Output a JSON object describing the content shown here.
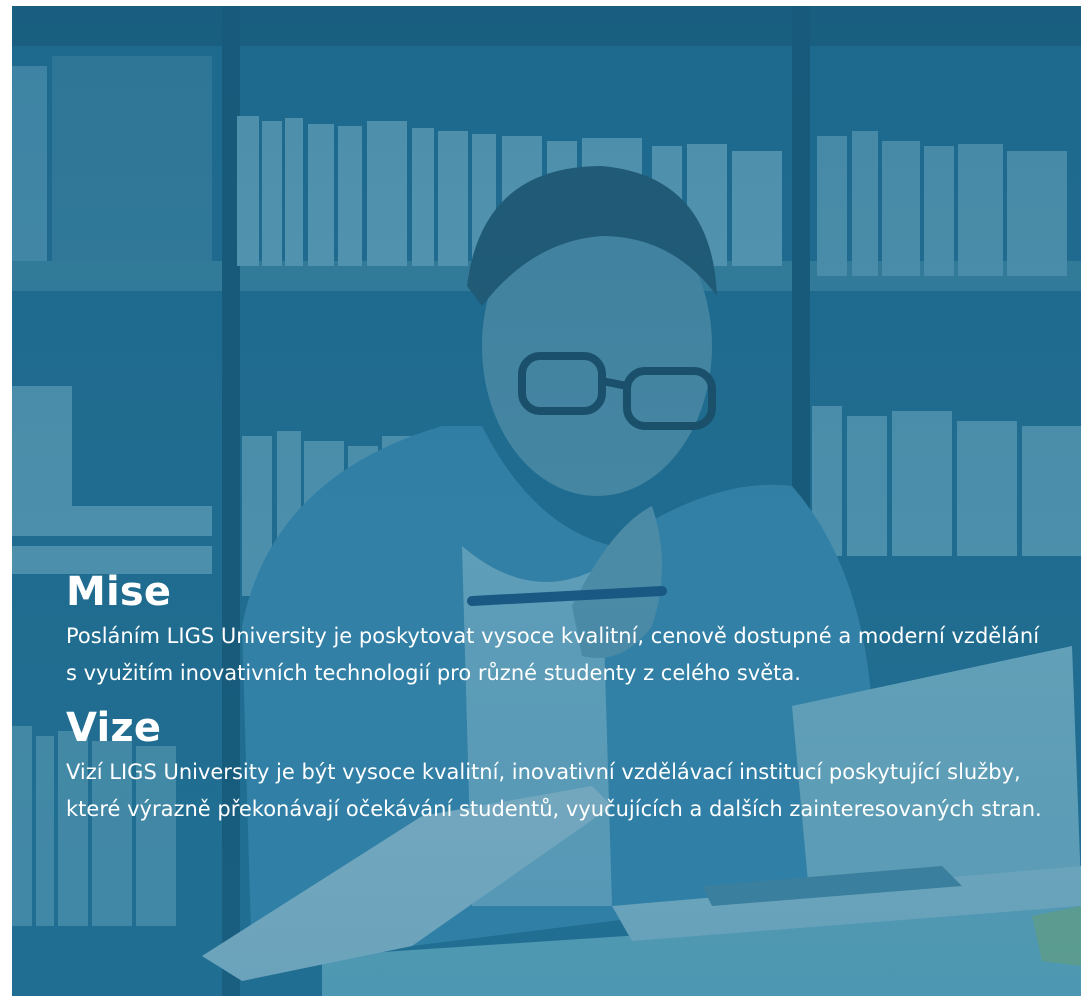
{
  "hero": {
    "image_alt": "Student with glasses working on a laptop in a library",
    "overlay_color": "#1e6b8f"
  },
  "mission": {
    "title": "Mise",
    "text": "Posláním LIGS University je poskytovat vysoce kvalitní, cenově dostupné a moderní vzdělání s využitím inovativních technologií pro různé studenty z celého světa."
  },
  "vision": {
    "title": "Vize",
    "text": "Vizí LIGS University je být vysoce kvalitní, inovativní vzdělávací institucí poskytující služby, které výrazně překonávají očekávání studentů, vyučujících a dalších zainteresovaných stran."
  }
}
